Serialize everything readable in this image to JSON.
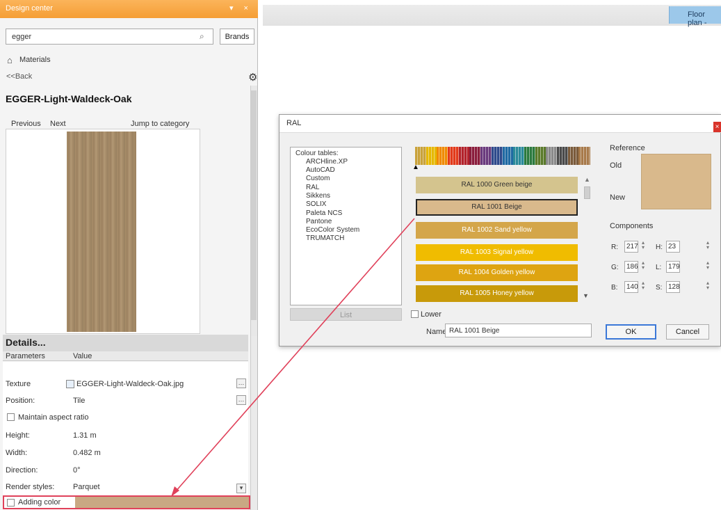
{
  "panel": {
    "title": "Design center",
    "controls": "▾ ×",
    "search_value": "egger",
    "brands_label": "Brands",
    "breadcrumb": "Materials",
    "back_label": "<<Back",
    "material_title": "EGGER-Light-Waldeck-Oak",
    "previous": "Previous",
    "next": "Next",
    "jump": "Jump to category"
  },
  "details": {
    "header": "Details...",
    "col_parameters": "Parameters",
    "col_value": "Value",
    "texture_label": "Texture",
    "texture_value": "EGGER-Light-Waldeck-Oak.jpg",
    "position_label": "Position:",
    "position_value": "Tile",
    "aspect_label": "Maintain aspect ratio",
    "height_label": "Height:",
    "height_value": "1.31 m",
    "width_label": "Width:",
    "width_value": "0.482 m",
    "direction_label": "Direction:",
    "direction_value": "0°",
    "render_label": "Render styles:",
    "render_value": "Parquet",
    "adding_color_label": "Adding color"
  },
  "top_bar": {
    "floor_plan_tab": "Floor plan -"
  },
  "ral_dialog": {
    "title": "RAL",
    "colour_tables_label": "Colour tables:",
    "tables": [
      "ARCHline.XP",
      "AutoCAD",
      "Custom",
      "RAL",
      "Sikkens",
      "SOLIX",
      "Paleta NCS",
      "Pantone",
      "EcoColor System",
      "TRUMATCH"
    ],
    "list_button": "List",
    "swatches": [
      {
        "name": "RAL 1000 Green beige",
        "color": "#d4c48e",
        "text_color": "#333333"
      },
      {
        "name": "RAL 1001 Beige",
        "color": "#d9b98c",
        "text_color": "#333333"
      },
      {
        "name": "RAL 1002 Sand yellow",
        "color": "#d4a64a",
        "text_color": "#ffffff"
      },
      {
        "name": "RAL 1003 Signal yellow",
        "color": "#f0bc00",
        "text_color": "#ffffff"
      },
      {
        "name": "RAL 1004 Golden yellow",
        "color": "#dea411",
        "text_color": "#ffffff"
      },
      {
        "name": "RAL 1005 Honey yellow",
        "color": "#c89a0a",
        "text_color": "#ffffff"
      }
    ],
    "palette_colors": [
      "#c9a23a",
      "#e6b800",
      "#f08a00",
      "#e33a1a",
      "#b3222b",
      "#8a1c3b",
      "#6a3a7d",
      "#2e4a8c",
      "#1f6aa3",
      "#2a8a9a",
      "#2b7a3e",
      "#5a7a2a",
      "#8a8a8a",
      "#4a4a4a",
      "#7a5a3a",
      "#a87a4a"
    ],
    "lower_label": "Lower",
    "name_label": "Name",
    "name_value": "RAL 1001 Beige",
    "reference_label": "Reference",
    "old_label": "Old",
    "new_label": "New",
    "reference_color": "#d9b98c",
    "components_label": "Components",
    "components": {
      "r_label": "R:",
      "r_value": "217",
      "g_label": "G:",
      "g_value": "186",
      "b_label": "B:",
      "b_value": "140",
      "h_label": "H:",
      "h_value": "23",
      "l_label": "L:",
      "l_value": "179",
      "s_label": "S:",
      "s_value": "128"
    },
    "ok_label": "OK",
    "cancel_label": "Cancel"
  },
  "colors": {
    "accent_orange": "#f59e35",
    "highlight_red": "#e0415a",
    "adding_color_swatch": "#c9a883"
  }
}
